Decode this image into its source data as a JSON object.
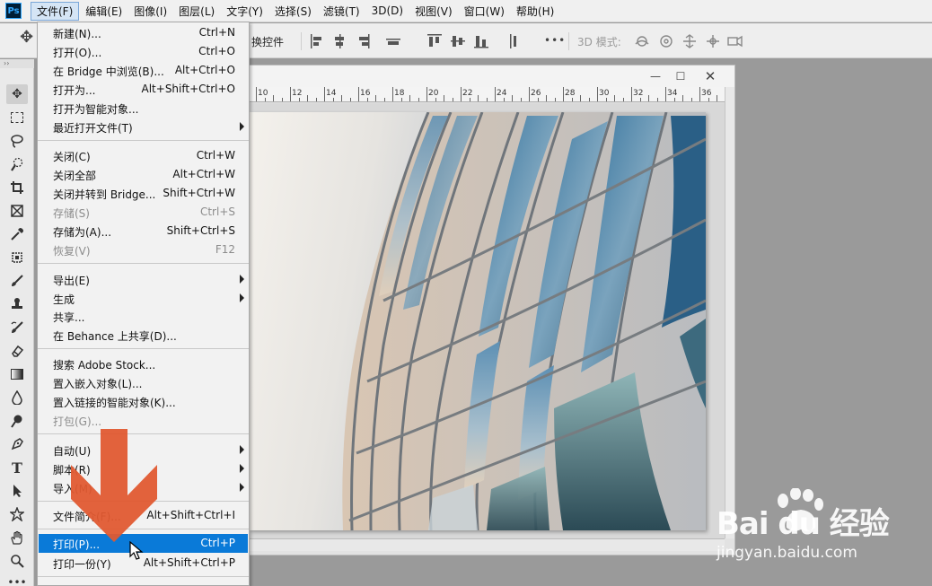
{
  "menubar": {
    "logo": "Ps",
    "items": [
      {
        "label": "文件(F)"
      },
      {
        "label": "编辑(E)"
      },
      {
        "label": "图像(I)"
      },
      {
        "label": "图层(L)"
      },
      {
        "label": "文字(Y)"
      },
      {
        "label": "选择(S)"
      },
      {
        "label": "滤镜(T)"
      },
      {
        "label": "3D(D)"
      },
      {
        "label": "视图(V)"
      },
      {
        "label": "窗口(W)"
      },
      {
        "label": "帮助(H)"
      }
    ]
  },
  "options_bar": {
    "transform_label": "换控件",
    "mode_3d_label": "3D 模式:",
    "more_label": "•••"
  },
  "collapse_label": "››",
  "file_menu": {
    "items": [
      {
        "label": "新建(N)...",
        "shortcut": "Ctrl+N",
        "disabled": false,
        "submenu": false
      },
      {
        "label": "打开(O)...",
        "shortcut": "Ctrl+O",
        "disabled": false,
        "submenu": false
      },
      {
        "label": "在 Bridge 中浏览(B)...",
        "shortcut": "Alt+Ctrl+O",
        "disabled": false,
        "submenu": false
      },
      {
        "label": "打开为...",
        "shortcut": "Alt+Shift+Ctrl+O",
        "disabled": false,
        "submenu": false
      },
      {
        "label": "打开为智能对象...",
        "shortcut": "",
        "disabled": false,
        "submenu": false
      },
      {
        "label": "最近打开文件(T)",
        "shortcut": "",
        "disabled": false,
        "submenu": true
      },
      {
        "label": "关闭(C)",
        "shortcut": "Ctrl+W",
        "disabled": false,
        "submenu": false
      },
      {
        "label": "关闭全部",
        "shortcut": "Alt+Ctrl+W",
        "disabled": false,
        "submenu": false
      },
      {
        "label": "关闭并转到 Bridge...",
        "shortcut": "Shift+Ctrl+W",
        "disabled": false,
        "submenu": false
      },
      {
        "label": "存储(S)",
        "shortcut": "Ctrl+S",
        "disabled": true,
        "submenu": false
      },
      {
        "label": "存储为(A)...",
        "shortcut": "Shift+Ctrl+S",
        "disabled": false,
        "submenu": false
      },
      {
        "label": "恢复(V)",
        "shortcut": "F12",
        "disabled": true,
        "submenu": false
      },
      {
        "label": "导出(E)",
        "shortcut": "",
        "disabled": false,
        "submenu": true
      },
      {
        "label": "生成",
        "shortcut": "",
        "disabled": false,
        "submenu": true
      },
      {
        "label": "共享...",
        "shortcut": "",
        "disabled": false,
        "submenu": false
      },
      {
        "label": "在 Behance 上共享(D)...",
        "shortcut": "",
        "disabled": false,
        "submenu": false
      },
      {
        "label": "搜索 Adobe Stock...",
        "shortcut": "",
        "disabled": false,
        "submenu": false
      },
      {
        "label": "置入嵌入对象(L)...",
        "shortcut": "",
        "disabled": false,
        "submenu": false
      },
      {
        "label": "置入链接的智能对象(K)...",
        "shortcut": "",
        "disabled": false,
        "submenu": false
      },
      {
        "label": "打包(G)...",
        "shortcut": "",
        "disabled": true,
        "submenu": false
      },
      {
        "label": "自动(U)",
        "shortcut": "",
        "disabled": false,
        "submenu": true
      },
      {
        "label": "脚本(R)",
        "shortcut": "",
        "disabled": false,
        "submenu": true
      },
      {
        "label": "导入(M)",
        "shortcut": "",
        "disabled": false,
        "submenu": true
      },
      {
        "label": "文件简介(F)...",
        "shortcut": "Alt+Shift+Ctrl+I",
        "disabled": false,
        "submenu": false
      },
      {
        "label": "打印(P)...",
        "shortcut": "Ctrl+P",
        "disabled": false,
        "submenu": false,
        "highlighted": true
      },
      {
        "label": "打印一份(Y)",
        "shortcut": "Alt+Shift+Ctrl+P",
        "disabled": false,
        "submenu": false
      }
    ]
  },
  "document": {
    "ruler_labels": [
      "10",
      "12",
      "14",
      "16",
      "18",
      "20",
      "22",
      "24",
      "26",
      "28",
      "30",
      "32",
      "34",
      "36"
    ],
    "min_glyph": "—",
    "max_glyph": "☐",
    "close_glyph": "✕"
  },
  "watermark": {
    "brand": "Bai du 经验",
    "url": "jingyan.baidu.com"
  },
  "colors": {
    "highlight": "#0a7ad8",
    "arrow": "#e05a32",
    "menubar_active": "#d5e5f5"
  }
}
